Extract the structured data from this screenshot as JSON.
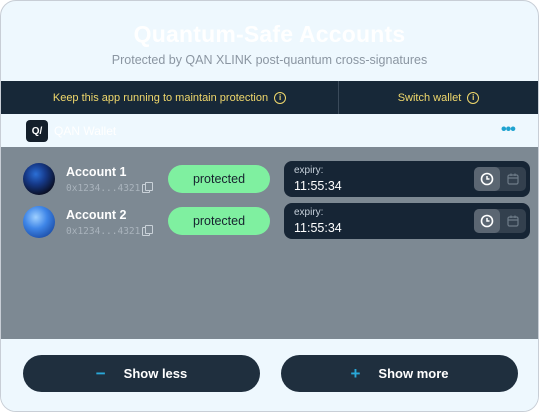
{
  "header": {
    "title": "Quantum-Safe Accounts",
    "subtitle": "Protected by QAN XLINK post-quantum cross-signatures"
  },
  "infobar": {
    "keep_running": "Keep this app running to maintain protection",
    "switch_wallet": "Switch wallet",
    "info_symbol": "i"
  },
  "wallet": {
    "logo_text": "Q/",
    "name": "QAN Wallet",
    "menu_symbol": "•••"
  },
  "accounts": [
    {
      "name": "Account 1",
      "address": "0x1234...4321",
      "status": "protected",
      "expiry_label": "expiry:",
      "expiry_time": "11:55:34"
    },
    {
      "name": "Account 2",
      "address": "0x1234...4321",
      "status": "protected",
      "expiry_label": "expiry:",
      "expiry_time": "11:55:34"
    }
  ],
  "buttons": {
    "show_less": "Show less",
    "show_less_symbol": "−",
    "show_more": "Show more",
    "show_more_symbol": "+"
  },
  "colors": {
    "accent": "#29a8d8",
    "protected_badge": "#7ff0a0",
    "info_text": "#f0d86c",
    "dark_panel": "#162535"
  }
}
